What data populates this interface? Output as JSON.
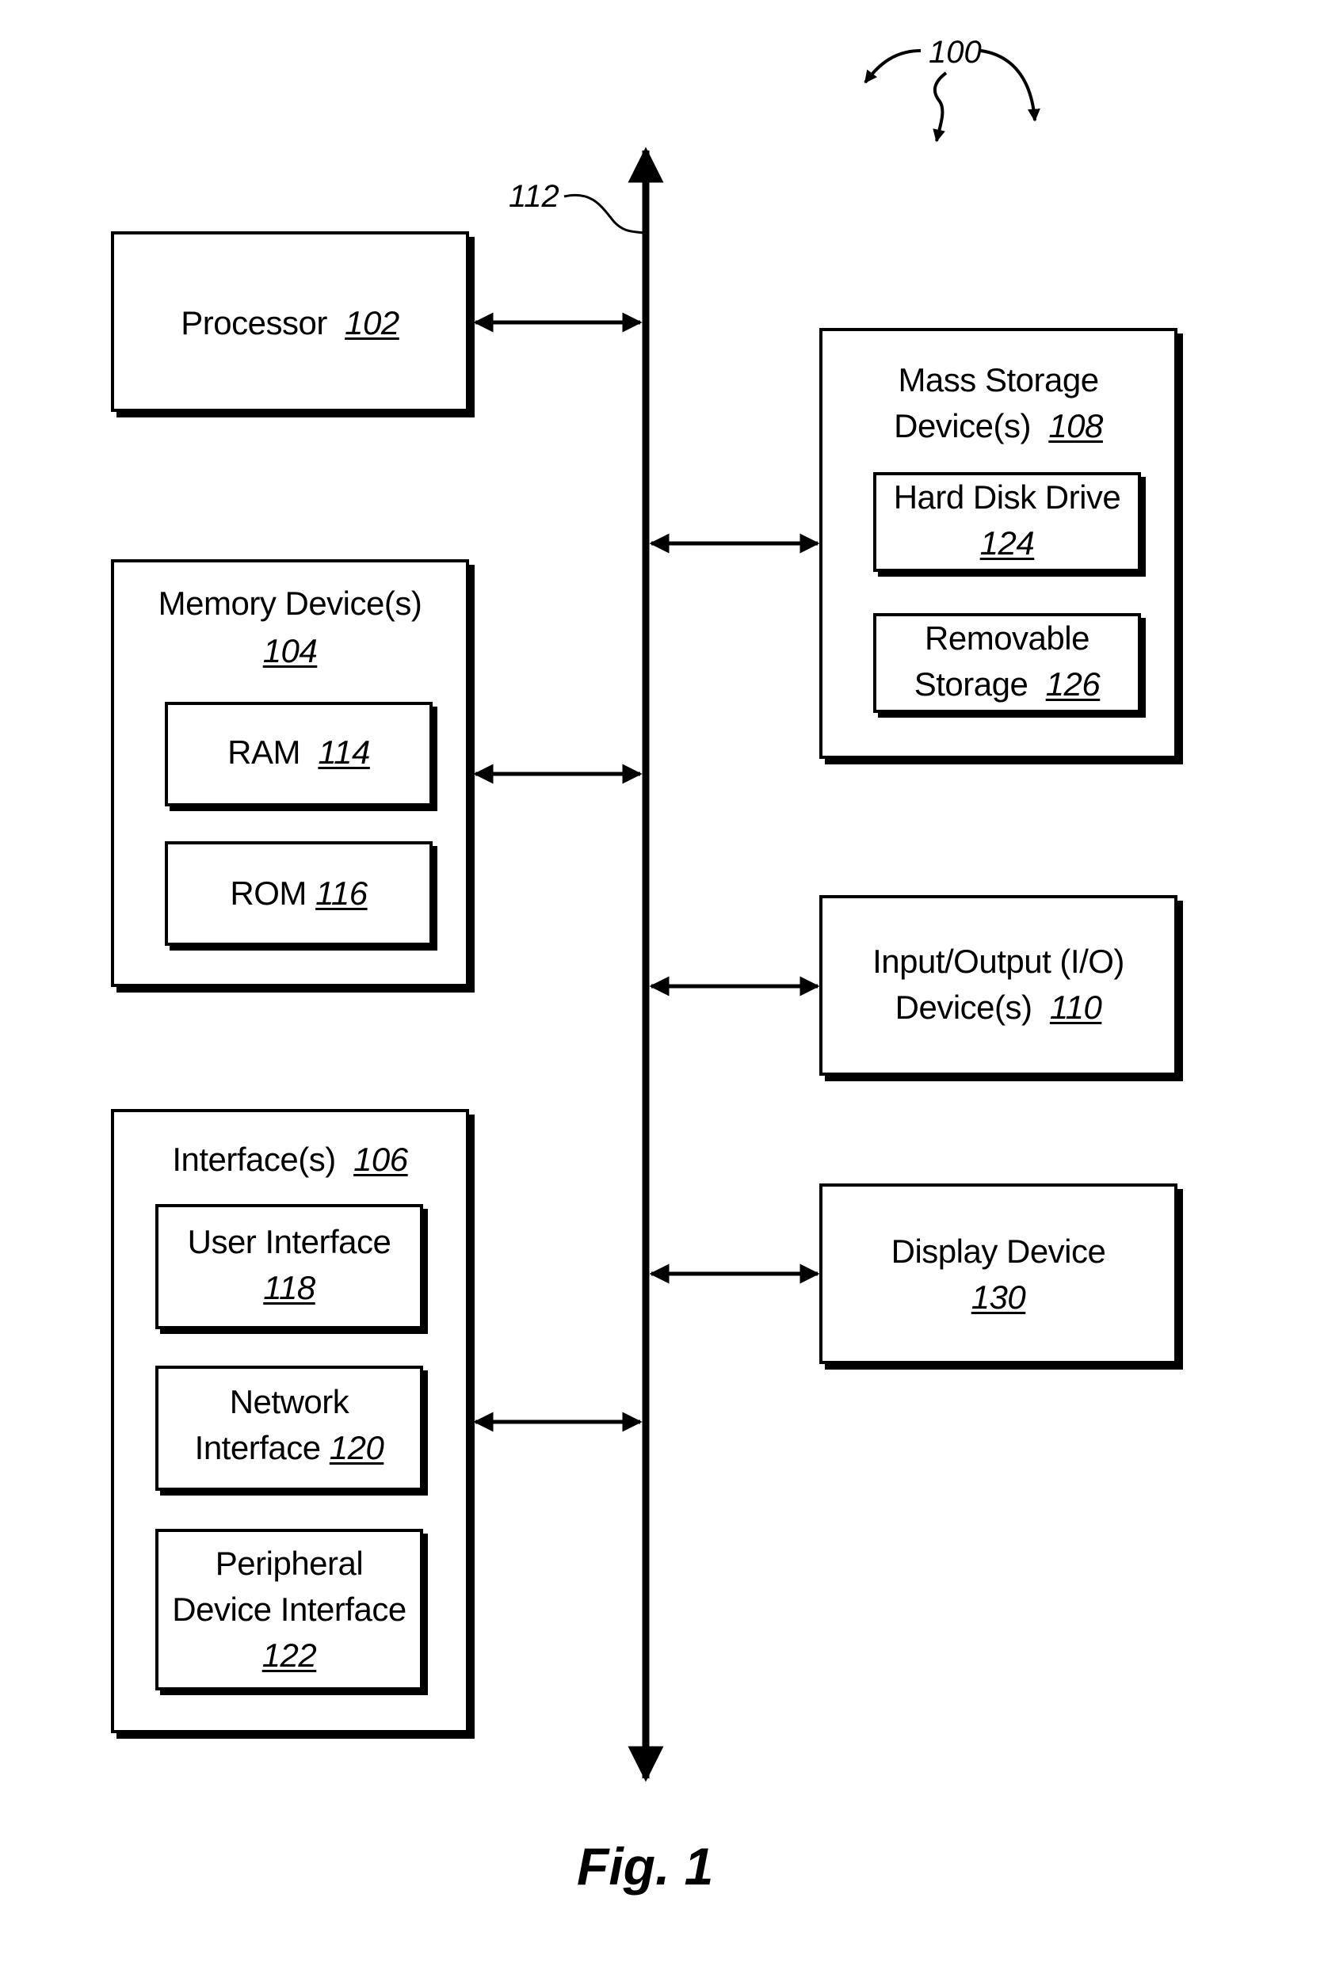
{
  "figure": {
    "caption": "Fig. 1",
    "system_ref": "100",
    "bus_ref": "112",
    "colors": {
      "line": "#000000",
      "background": "#ffffff"
    }
  },
  "blocks": {
    "processor": {
      "label": "Processor",
      "ref": "102"
    },
    "memory": {
      "label": "Memory Device(s)",
      "ref": "104",
      "children": [
        {
          "label": "RAM",
          "ref": "114"
        },
        {
          "label": "ROM",
          "ref": "116"
        }
      ]
    },
    "interfaces": {
      "label": "Interface(s)",
      "ref": "106",
      "children": [
        {
          "label_line1": "User Interface",
          "label_line2": "",
          "ref": "118"
        },
        {
          "label_line1": "Network",
          "label_line2": "Interface",
          "ref": "120"
        },
        {
          "label_line1": "Peripheral",
          "label_line2": "Device Interface",
          "ref": "122"
        }
      ]
    },
    "mass_storage": {
      "label_line1": "Mass Storage",
      "label_line2": "Device(s)",
      "ref": "108",
      "children": [
        {
          "label_line1": "Hard Disk Drive",
          "label_line2": "",
          "ref": "124"
        },
        {
          "label_line1": "Removable",
          "label_line2": "Storage",
          "ref": "126"
        }
      ]
    },
    "io": {
      "label_line1": "Input/Output (I/O)",
      "label_line2": "Device(s)",
      "ref": "110"
    },
    "display": {
      "label": "Display Device",
      "ref": "130"
    }
  }
}
